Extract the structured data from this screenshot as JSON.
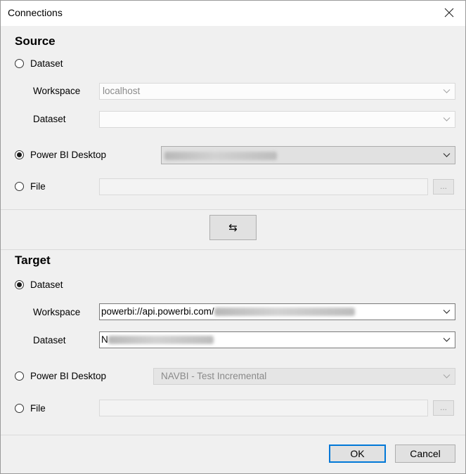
{
  "window": {
    "title": "Connections"
  },
  "source": {
    "heading": "Source",
    "dataset_option": "Dataset",
    "workspace_label": "Workspace",
    "workspace_value": "localhost",
    "dataset_label": "Dataset",
    "dataset_value": "",
    "pbi_option": "Power BI Desktop",
    "pbi_value_visible": "",
    "file_option": "File",
    "file_value": "",
    "browse_label": "...",
    "selected": "Power BI Desktop"
  },
  "swap": {
    "glyph": "⇆"
  },
  "target": {
    "heading": "Target",
    "dataset_option": "Dataset",
    "workspace_label": "Workspace",
    "workspace_value_prefix": "powerbi://api.powerbi.com/",
    "dataset_label": "Dataset",
    "dataset_value_prefix": "N",
    "pbi_option": "Power BI Desktop",
    "pbi_value": "NAVBI - Test Incremental",
    "file_option": "File",
    "file_value": "",
    "browse_label": "...",
    "selected": "Dataset"
  },
  "footer": {
    "ok_label": "OK",
    "cancel_label": "Cancel"
  },
  "icons": {
    "close": "close-icon",
    "dropdown": "chevron-down-icon",
    "swap": "swap-arrows-icon"
  },
  "colors": {
    "primary_button_border": "#0078d7",
    "dialog_background": "#f0f0f0"
  }
}
